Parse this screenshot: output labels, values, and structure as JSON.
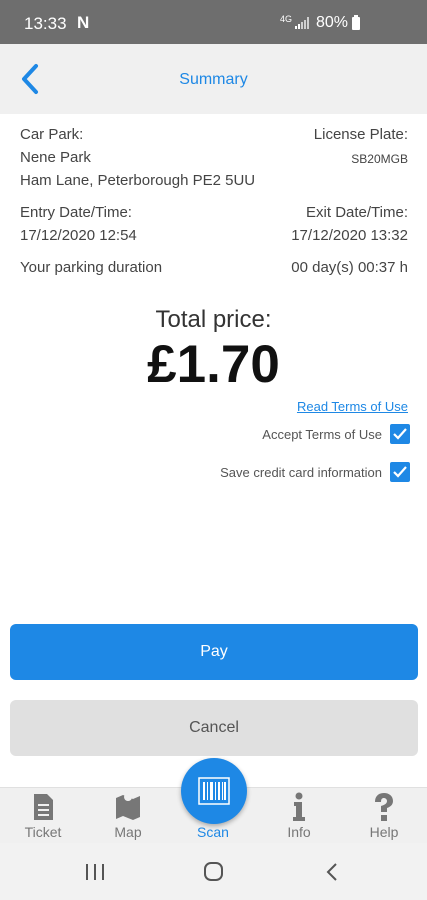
{
  "status_bar": {
    "time": "13:33",
    "notification_icon": "N",
    "network_type": "4G",
    "battery": "80%"
  },
  "header": {
    "title": "Summary",
    "back_icon": "chevron-left-icon"
  },
  "summary": {
    "car_park_label": "Car Park:",
    "car_park_name": "Nene Park",
    "car_park_address": "Ham Lane, Peterborough PE2 5UU",
    "license_plate_label": "License Plate:",
    "license_plate_value": "SB20MGB",
    "entry_label": "Entry Date/Time:",
    "entry_value": "17/12/2020 12:54",
    "exit_label": "Exit Date/Time:",
    "exit_value": "17/12/2020 13:32",
    "duration_label": "Your parking duration",
    "duration_value": "00 day(s) 00:37 h"
  },
  "total": {
    "label": "Total price:",
    "price": "£1.70"
  },
  "terms": {
    "link": "Read Terms of Use",
    "accept_label": "Accept Terms of Use",
    "accept_checked": true,
    "save_card_label": "Save credit card information",
    "save_card_checked": true
  },
  "buttons": {
    "pay": "Pay",
    "cancel": "Cancel"
  },
  "tabs": [
    {
      "label": "Ticket",
      "icon": "ticket-icon"
    },
    {
      "label": "Map",
      "icon": "map-icon"
    },
    {
      "label": "Scan",
      "icon": "barcode-icon",
      "active": true
    },
    {
      "label": "Info",
      "icon": "info-icon"
    },
    {
      "label": "Help",
      "icon": "help-icon"
    }
  ],
  "colors": {
    "accent": "#1e88e5",
    "status_bar": "#6e6e6e",
    "header_bg": "#f0f0f0",
    "cancel_bg": "#e0e0e0"
  }
}
